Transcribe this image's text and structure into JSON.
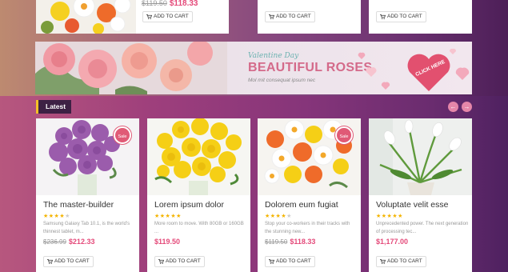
{
  "colors": {
    "accent": "#e44a7a",
    "price": "#e44a7a",
    "star": "#f4b400",
    "latest_bg": "#3d2144",
    "latest_border": "#f4c026",
    "sale": "#e05a76"
  },
  "top_row": [
    {
      "old_price": "$119.50",
      "new_price": "$118.33",
      "add_to_cart": "ADD TO CART"
    },
    {
      "add_to_cart": "ADD TO CART"
    },
    {
      "add_to_cart": "ADD TO CART"
    }
  ],
  "banner": {
    "subtitle": "Valentine Day",
    "title": "BEAUTIFUL ROSES",
    "note": "Mol mit consequat ipsum nec",
    "cta": "CLICK HERE"
  },
  "latest": {
    "label": "Latest",
    "prev_icon": "arrow-left-icon",
    "next_icon": "arrow-right-icon"
  },
  "products": [
    {
      "name": "The master-builder",
      "sale": "Sale",
      "rating": 4,
      "desc": "Samsung Galaxy Tab 10.1, is the world's thinnest tablet, m...",
      "old_price": "$236.99",
      "new_price": "$212.33",
      "add_to_cart": "ADD TO CART"
    },
    {
      "name": "Lorem ipsum dolor",
      "sale": "",
      "rating": 5,
      "desc": "More room to move. With 80GB or 160GB ...",
      "old_price": "",
      "new_price": "$119.50",
      "add_to_cart": "ADD TO CART"
    },
    {
      "name": "Dolorem eum fugiat",
      "sale": "Sale",
      "rating": 4,
      "desc": "Stop your co-workers in their tracks with the stunning new...",
      "old_price": "$119.50",
      "new_price": "$118.33",
      "add_to_cart": "ADD TO CART"
    },
    {
      "name": "Voluptate velit esse",
      "sale": "",
      "rating": 5,
      "desc": "Unprecedented power. The next generation of processing tec...",
      "old_price": "",
      "new_price": "$1,177.00",
      "add_to_cart": "ADD TO CART"
    }
  ]
}
